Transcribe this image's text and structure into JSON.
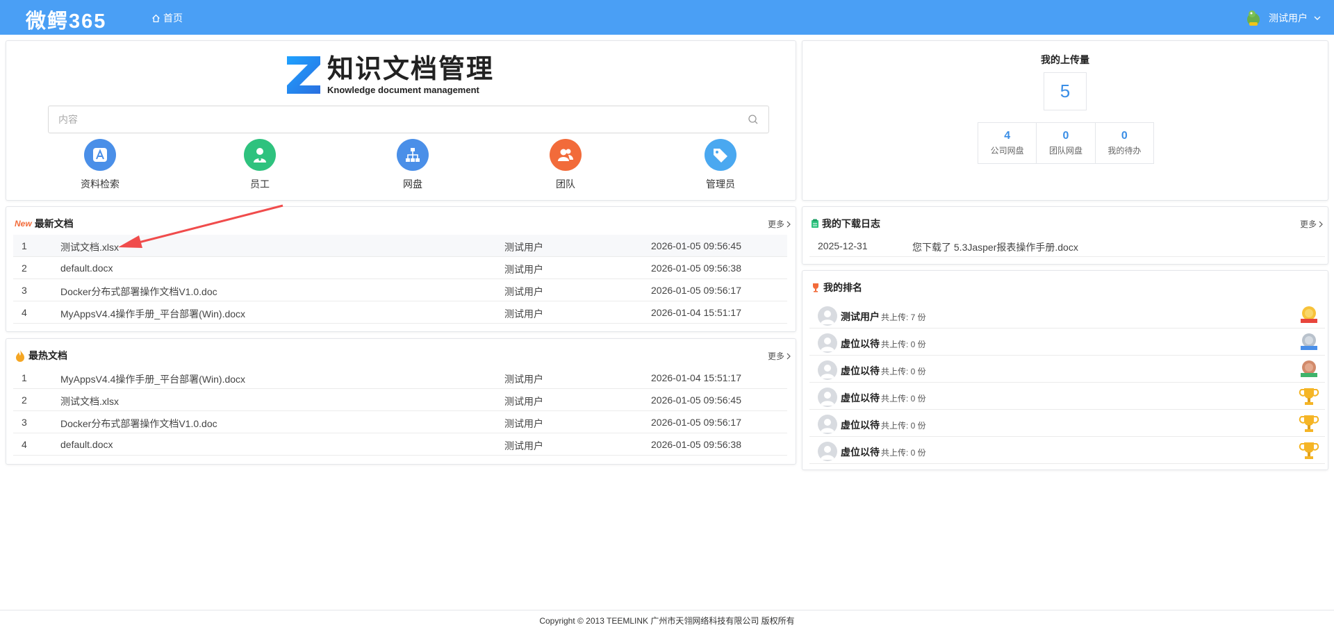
{
  "header": {
    "brand": "微鳄365",
    "home_label": "首页",
    "user_name": "测试用户"
  },
  "search": {
    "title_cn": "知识文档管理",
    "title_en": "Knowledge document management",
    "placeholder": "内容",
    "quick_items": [
      {
        "label": "资料检索",
        "icon": "app-store-icon",
        "color": "#4a8fe8"
      },
      {
        "label": "员工",
        "icon": "employee-icon",
        "color": "#2ec27e"
      },
      {
        "label": "网盘",
        "icon": "org-tree-icon",
        "color": "#4a8fe8"
      },
      {
        "label": "团队",
        "icon": "team-icon",
        "color": "#f26b3a"
      },
      {
        "label": "管理员",
        "icon": "tag-icon",
        "color": "#4aa8f0"
      }
    ]
  },
  "latest": {
    "title": "最新文档",
    "new_badge": "New",
    "more_label": "更多",
    "rows": [
      {
        "index": "1",
        "name": "测试文档.xlsx",
        "user": "测试用户",
        "date": "2026-01-05 09:56:45"
      },
      {
        "index": "2",
        "name": "default.docx",
        "user": "测试用户",
        "date": "2026-01-05 09:56:38"
      },
      {
        "index": "3",
        "name": "Docker分布式部署操作文档V1.0.doc",
        "user": "测试用户",
        "date": "2026-01-05 09:56:17"
      },
      {
        "index": "4",
        "name": "MyAppsV4.4操作手册_平台部署(Win).docx",
        "user": "测试用户",
        "date": "2026-01-04 15:51:17"
      }
    ]
  },
  "hottest": {
    "title": "最热文档",
    "more_label": "更多",
    "rows": [
      {
        "index": "1",
        "name": "MyAppsV4.4操作手册_平台部署(Win).docx",
        "user": "测试用户",
        "date": "2026-01-04 15:51:17"
      },
      {
        "index": "2",
        "name": "测试文档.xlsx",
        "user": "测试用户",
        "date": "2026-01-05 09:56:45"
      },
      {
        "index": "3",
        "name": "Docker分布式部署操作文档V1.0.doc",
        "user": "测试用户",
        "date": "2026-01-05 09:56:17"
      },
      {
        "index": "4",
        "name": "default.docx",
        "user": "测试用户",
        "date": "2026-01-05 09:56:38"
      }
    ]
  },
  "upload": {
    "title": "我的上传量",
    "total": "5",
    "stats": [
      {
        "value": "4",
        "label": "公司网盘"
      },
      {
        "value": "0",
        "label": "团队网盘"
      },
      {
        "value": "0",
        "label": "我的待办"
      }
    ]
  },
  "download_log": {
    "title": "我的下载日志",
    "more_label": "更多",
    "rows": [
      {
        "date": "2025-12-31",
        "text": "您下载了 5.3Jasper报表操作手册.docx"
      }
    ]
  },
  "ranking": {
    "title": "我的排名",
    "rows": [
      {
        "name": "测试用户",
        "count": "共上传: 7 份",
        "badge": "gold-medal-icon"
      },
      {
        "name": "虚位以待",
        "count": "共上传: 0 份",
        "badge": "silver-medal-icon"
      },
      {
        "name": "虚位以待",
        "count": "共上传: 0 份",
        "badge": "bronze-medal-icon"
      },
      {
        "name": "虚位以待",
        "count": "共上传: 0 份",
        "badge": "trophy-icon"
      },
      {
        "name": "虚位以待",
        "count": "共上传: 0 份",
        "badge": "trophy-icon"
      },
      {
        "name": "虚位以待",
        "count": "共上传: 0 份",
        "badge": "trophy-icon"
      }
    ]
  },
  "footer": {
    "copyright": "Copyright © 2013 TEEMLINK 广州市天翎网络科技有限公司 版权所有"
  }
}
